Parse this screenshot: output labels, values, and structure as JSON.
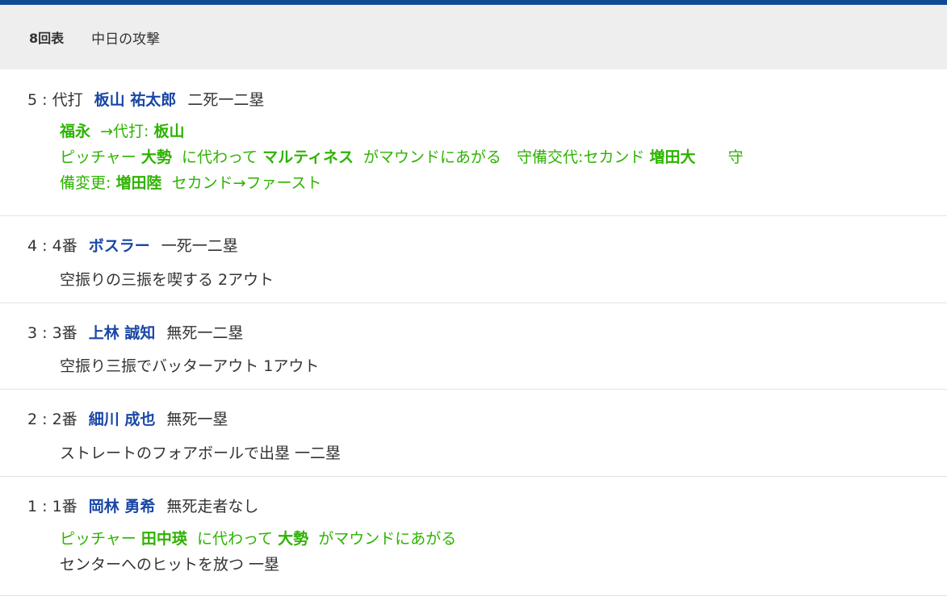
{
  "header": {
    "inning": "8回表",
    "team_attack": "中日の攻撃"
  },
  "plays": [
    {
      "num": "5",
      "order": "代打",
      "batter": "板山 祐太郎",
      "situation": "二死一二塁",
      "sub1_name": "福永",
      "sub1_rest": "→代打:",
      "sub1_new": "板山",
      "pitch_prefix": "ピッチャー",
      "pitch_old": "大勢",
      "pitch_mid": "に代わって",
      "pitch_new": "マルティネス",
      "pitch_suffix": "がマウンドにあがる　守備交代:セカンド",
      "def_new": "増田大",
      "def_tail": "守",
      "line3_pre": "備変更:",
      "line3_name": "増田陸",
      "line3_rest": "セカンド→ファースト"
    },
    {
      "num": "4",
      "order": "4番",
      "batter": "ボスラー",
      "situation": "一死一二塁",
      "result": "空振りの三振を喫する 2アウト"
    },
    {
      "num": "3",
      "order": "3番",
      "batter": "上林 誠知",
      "situation": "無死一二塁",
      "result": "空振り三振でバッターアウト 1アウト"
    },
    {
      "num": "2",
      "order": "2番",
      "batter": "細川 成也",
      "situation": "無死一塁",
      "result": "ストレートのフォアボールで出塁 一二塁"
    },
    {
      "num": "1",
      "order": "1番",
      "batter": "岡林 勇希",
      "situation": "無死走者なし",
      "pitch_prefix": "ピッチャー",
      "pitch_old": "田中瑛",
      "pitch_mid": "に代わって",
      "pitch_new": "大勢",
      "pitch_suffix": "がマウンドにあがる",
      "result": "センターへのヒットを放つ 一塁"
    }
  ]
}
